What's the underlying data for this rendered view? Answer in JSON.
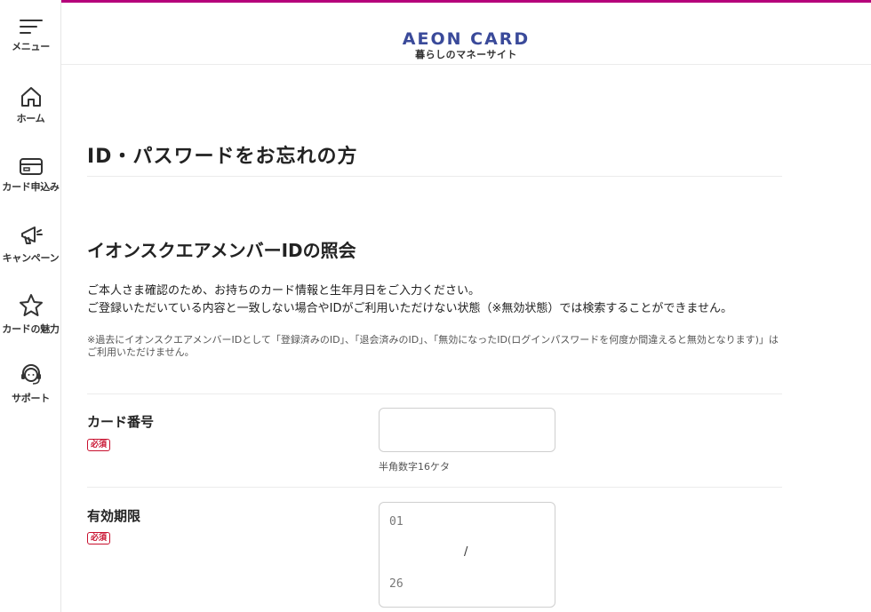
{
  "sidebar": {
    "items": [
      {
        "label": "メニュー",
        "icon": "menu-icon"
      },
      {
        "label": "ホーム",
        "icon": "home-icon"
      },
      {
        "label": "カード申込み",
        "icon": "card-icon"
      },
      {
        "label": "キャンペーン",
        "icon": "megaphone-icon"
      },
      {
        "label": "カードの魅力",
        "icon": "star-icon"
      },
      {
        "label": "サポート",
        "icon": "support-agent-icon"
      }
    ]
  },
  "header": {
    "logo_main": "AEON CARD",
    "logo_sub": "暮らしのマネーサイト",
    "accent_color": "#b5007a",
    "brand_color": "#3a4a9a"
  },
  "main": {
    "page_title": "ID・パスワードをお忘れの方",
    "section_title": "イオンスクエアメンバーIDの照会",
    "description_line1": "ご本人さま確認のため、お持ちのカード情報と生年月日をご入力ください。",
    "description_line2": "ご登録いただいている内容と一致しない場合やIDがご利用いただけない状態（※無効状態）では検索することができません。",
    "note": "※過去にイオンスクエアメンバーIDとして「登録済みのID」、「退会済みのID」、「無効になったID(ログインパスワードを何度か間違えると無効となります)」はご利用いただけません。",
    "fields": {
      "card_number": {
        "label": "カード番号",
        "required_badge": "必須",
        "value": "",
        "hint": "半角数字16ケタ"
      },
      "expiry": {
        "label": "有効期限",
        "required_badge": "必須",
        "month": "01",
        "separator": "/",
        "year": "26"
      }
    }
  }
}
